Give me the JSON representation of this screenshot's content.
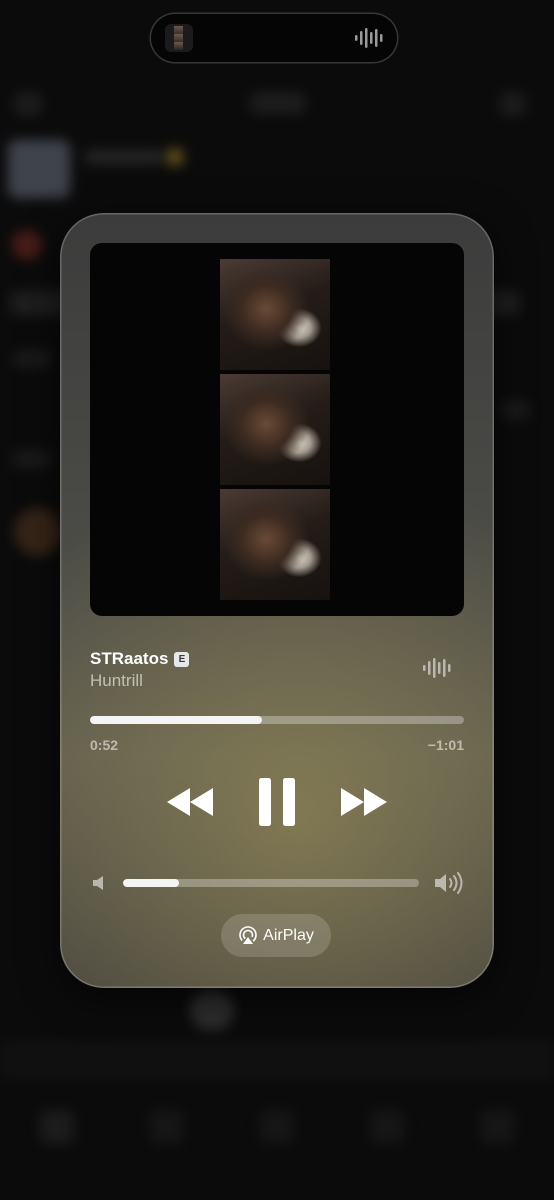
{
  "now_playing": {
    "title": "STRaatos",
    "explicit_badge": "E",
    "artist": "Huntrill",
    "elapsed": "0:52",
    "remaining": "−1:01",
    "progress_fraction": 0.46,
    "volume_fraction": 0.19
  },
  "airplay": {
    "label": "AirPlay"
  },
  "icons": {
    "island_waveform": "waveform-icon",
    "card_waveform": "waveform-icon",
    "rewind": "backward-icon",
    "pause": "pause-icon",
    "forward": "forward-icon",
    "volume_low": "speaker-low-icon",
    "volume_high": "speaker-high-icon",
    "airplay": "airplay-icon"
  },
  "colors": {
    "accent": "#ffffff",
    "card_bg": "#4a4a46",
    "track": "rgba(255,255,255,0.3)"
  }
}
